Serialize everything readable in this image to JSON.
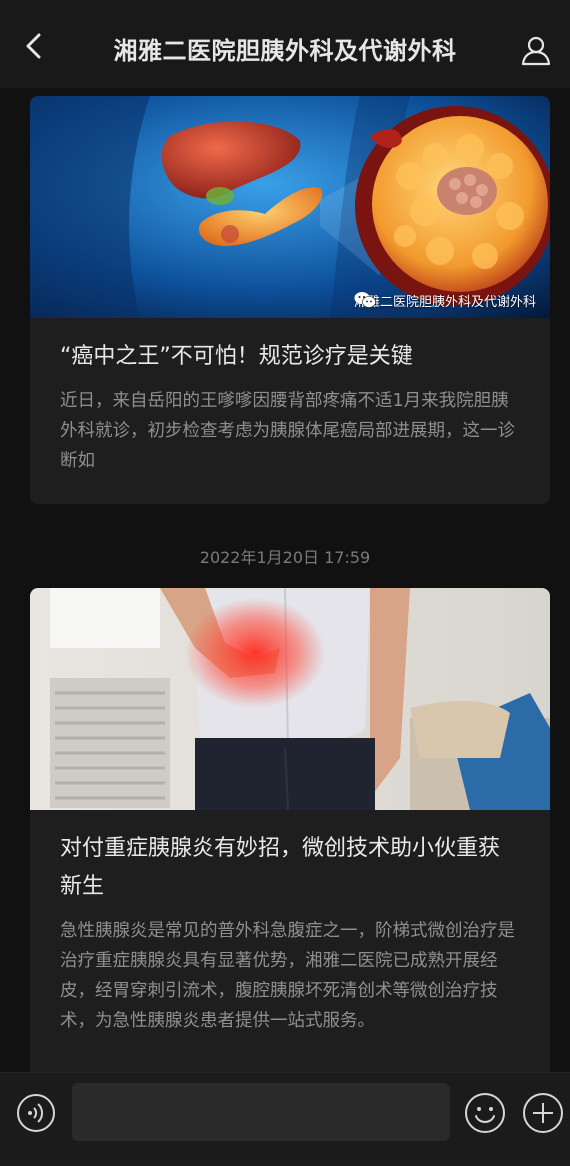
{
  "header": {
    "title": "湘雅二医院胆胰外科及代谢外科",
    "back_icon": "back-chevron-icon",
    "profile_icon": "person-icon"
  },
  "feed": {
    "articles": [
      {
        "title": "“癌中之王”不可怕！规范诊疗是关键",
        "summary": "近日，来自岳阳的王嗲嗲因腰背部疼痛不适1月来我院胆胰外科就诊，初步检查考虑为胰腺体尾癌局部进展期，这一诊断如",
        "cover_watermark": "湘雅二医院胆胰外科及代谢外科",
        "cover_desc_icon": "pancreas-illustration"
      },
      {
        "timestamp": "2022年1月20日 17:59",
        "title": "对付重症胰腺炎有妙招，微创技术助小伙重获新生",
        "summary": "急性胰腺炎是常见的普外科急腹症之一，阶梯式微创治疗是治疗重症胰腺炎具有显著优势，湘雅二医院已成熟开展经皮，经胃穿刺引流术，腹腔胰腺坏死清创术等微创治疗技术，为急性胰腺炎患者提供一站式服务。"
      }
    ]
  },
  "bottombar": {
    "input_placeholder": "",
    "voice_icon": "voice-icon",
    "emoji_icon": "emoji-icon",
    "plus_icon": "plus-icon"
  },
  "colors": {
    "background": "#111111",
    "card": "#1e1e1e",
    "title_text": "#e9e9e9",
    "summary_text": "#8f8f8f"
  }
}
